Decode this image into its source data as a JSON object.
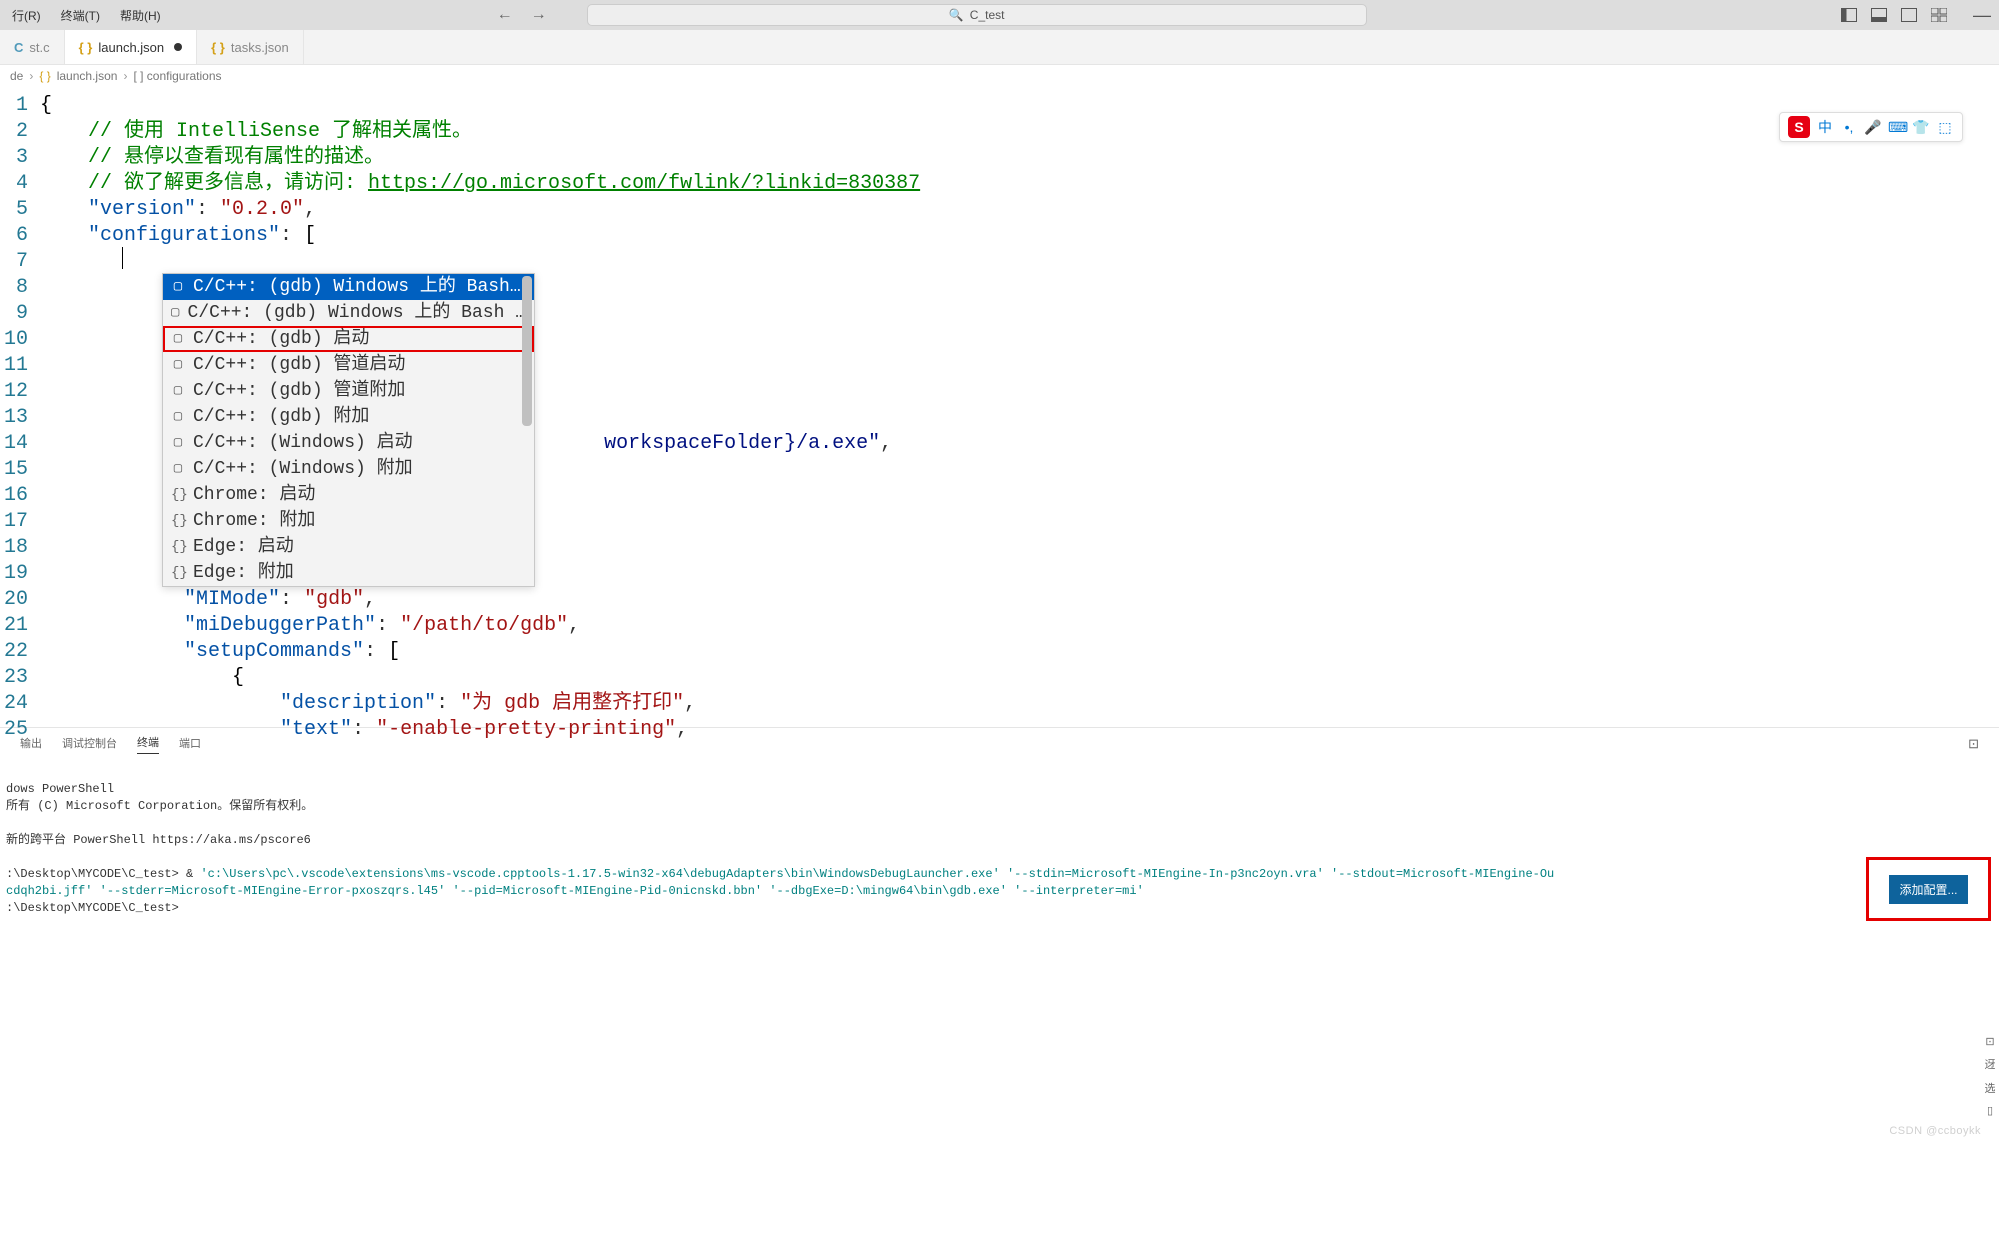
{
  "menubar": {
    "items": [
      "行(R)",
      "终端(T)",
      "帮助(H)"
    ],
    "search_prefix": "C_test",
    "search_icon": "🔍"
  },
  "tabs": [
    {
      "label": "st.c",
      "active": false,
      "icon": "C",
      "modified": false
    },
    {
      "label": "launch.json",
      "active": true,
      "icon": "{}",
      "modified": true
    },
    {
      "label": "tasks.json",
      "active": false,
      "icon": "{}",
      "modified": false
    }
  ],
  "breadcrumb": {
    "parts": [
      "de",
      "launch.json",
      "[ ] configurations"
    ],
    "icon": "{}"
  },
  "editor": {
    "lines": [
      "1",
      "2",
      "3",
      "4",
      "5",
      "6",
      "7",
      "8",
      "9",
      "10",
      "11",
      "12",
      "13",
      "14",
      "15",
      "16",
      "17",
      "18",
      "19",
      "20",
      "21",
      "22",
      "23",
      "24",
      "25"
    ],
    "code": {
      "l1": "{",
      "l2": "    // 使用 IntelliSense 了解相关属性。",
      "l3": "    // 悬停以查看现有属性的描述。",
      "l4_pre": "    // 欲了解更多信息，请访问: ",
      "l4_link": "https://go.microsoft.com/fwlink/?linkid=830387",
      "l5_k": "    \"version\"",
      "l5_v": "\"0.2.0\"",
      "l6_k": "    \"configurations\"",
      "l6_v": "[",
      "l14_frag": "workspaceFolder}/a.exe\"",
      "l20_k": "            \"MIMode\"",
      "l20_v": "\"gdb\"",
      "l21_k": "            \"miDebuggerPath\"",
      "l21_v": "\"/path/to/gdb\"",
      "l22_k": "            \"setupCommands\"",
      "l22_v": "[",
      "l23": "                {",
      "l24_k": "                    \"description\"",
      "l24_v": "\"为 gdb 启用整齐打印\"",
      "l25_k": "                    \"text\"",
      "l25_v": "\"-enable-pretty-printing\""
    }
  },
  "suggest": {
    "items": [
      {
        "icon": "▢",
        "label": "C/C++: (gdb) Windows 上的 Bash…",
        "selected": true
      },
      {
        "icon": "▢",
        "label": "C/C++: (gdb) Windows 上的 Bash …"
      },
      {
        "icon": "▢",
        "label": "C/C++: (gdb) 启动",
        "highlighted": true
      },
      {
        "icon": "▢",
        "label": "C/C++: (gdb) 管道启动"
      },
      {
        "icon": "▢",
        "label": "C/C++: (gdb) 管道附加"
      },
      {
        "icon": "▢",
        "label": "C/C++: (gdb) 附加"
      },
      {
        "icon": "▢",
        "label": "C/C++: (Windows) 启动"
      },
      {
        "icon": "▢",
        "label": "C/C++: (Windows) 附加"
      },
      {
        "icon": "{}",
        "label": "Chrome: 启动"
      },
      {
        "icon": "{}",
        "label": "Chrome: 附加"
      },
      {
        "icon": "{}",
        "label": "Edge: 启动"
      },
      {
        "icon": "{}",
        "label": "Edge: 附加"
      }
    ]
  },
  "ime": {
    "logo": "S",
    "icons": [
      "中",
      "•,",
      "🎤",
      "⌨",
      "👕",
      "⬚"
    ]
  },
  "add_config": {
    "label": "添加配置..."
  },
  "panel": {
    "tabs": [
      "输出",
      "调试控制台",
      "终端",
      "端口"
    ],
    "active": "终端",
    "sidebar_icons": [
      "⊡",
      "迓",
      "选",
      "▯"
    ]
  },
  "terminal": {
    "lines": [
      "dows PowerShell",
      "所有 (C) Microsoft Corporation。保留所有权利。",
      "",
      "新的跨平台 PowerShell https://aka.ms/pscore6",
      "",
      ":\\Desktop\\MYCODE\\C_test> & ",
      "'c:\\Users\\pc\\.vscode\\extensions\\ms-vscode.cpptools-1.17.5-win32-x64\\debugAdapters\\bin\\WindowsDebugLauncher.exe' '--stdin=Microsoft-MIEngine-In-p3nc2oyn.vra' '--stdout=Microsoft-MIEngine-Ou",
      "cdqh2bi.jff' '--stderr=Microsoft-MIEngine-Error-pxoszqrs.l45' '--pid=Microsoft-MIEngine-Pid-0nicnskd.bbn' '--dbgExe=D:\\mingw64\\bin\\gdb.exe' '--interpreter=mi'",
      ":\\Desktop\\MYCODE\\C_test>"
    ]
  },
  "watermark": "CSDN @ccboykk"
}
